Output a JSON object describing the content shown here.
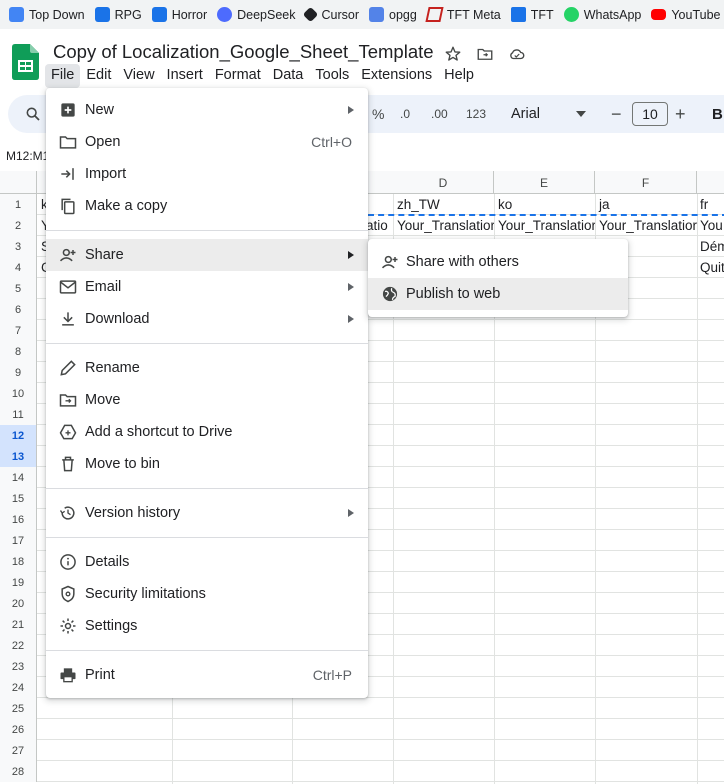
{
  "bookmarks": [
    {
      "label": "Top Down",
      "color": "#4285f4"
    },
    {
      "label": "RPG",
      "color": "#1a73e8"
    },
    {
      "label": "Horror",
      "color": "#1a73e8"
    },
    {
      "label": "DeepSeek",
      "color": "#4d6bfe"
    },
    {
      "label": "Cursor",
      "color": "#202124"
    },
    {
      "label": "opgg",
      "color": "#5383e8"
    },
    {
      "label": "TFT Meta",
      "color": "#c5221f"
    },
    {
      "label": "TFT",
      "color": "#1a73e8"
    },
    {
      "label": "WhatsApp",
      "color": "#25d366"
    },
    {
      "label": "YouTube",
      "color": "#ff0000"
    }
  ],
  "doc": {
    "title": "Copy of Localization_Google_Sheet_Template"
  },
  "menubar": [
    "File",
    "Edit",
    "View",
    "Insert",
    "Format",
    "Data",
    "Tools",
    "Extensions",
    "Help"
  ],
  "toolbar": {
    "percent": "%",
    "decimal_dec": ".0",
    "decimal_inc": ".00",
    "number_format": "123",
    "font": "Arial",
    "font_size": "10",
    "minus": "−",
    "plus": "+",
    "bold": "B"
  },
  "namebox": "M12:M1",
  "columns": [
    "D",
    "E",
    "F"
  ],
  "rows": [
    "1",
    "2",
    "3",
    "4",
    "5",
    "6",
    "7",
    "8",
    "9",
    "10",
    "11",
    "12",
    "13",
    "14",
    "15",
    "16",
    "17",
    "18",
    "19",
    "20",
    "21",
    "22",
    "23",
    "24",
    "25",
    "26",
    "27",
    "28"
  ],
  "selected_rows": [
    "12",
    "13"
  ],
  "cells": {
    "r1": [
      "k",
      "zh_TW",
      "ko",
      "ja",
      "fr"
    ],
    "r2": [
      "Y",
      "atio",
      "Your_Translatior",
      "Your_Translatior",
      "Your_Translatior",
      "You"
    ],
    "r3": [
      "S",
      "Dém"
    ],
    "r4": [
      "C",
      "Quit"
    ]
  },
  "file_menu": {
    "items": [
      {
        "label": "New",
        "icon": "new-sheet-icon",
        "submenu": true
      },
      {
        "label": "Open",
        "icon": "folder-open-icon",
        "shortcut": "Ctrl+O"
      },
      {
        "label": "Import",
        "icon": "import-icon"
      },
      {
        "label": "Make a copy",
        "icon": "copy-icon"
      },
      {
        "label": "Share",
        "icon": "person-add-icon",
        "submenu": true
      },
      {
        "label": "Email",
        "icon": "email-icon",
        "submenu": true
      },
      {
        "label": "Download",
        "icon": "download-icon",
        "submenu": true
      },
      {
        "label": "Rename",
        "icon": "pencil-icon"
      },
      {
        "label": "Move",
        "icon": "move-folder-icon"
      },
      {
        "label": "Add a shortcut to Drive",
        "icon": "drive-shortcut-icon"
      },
      {
        "label": "Move to bin",
        "icon": "trash-icon"
      },
      {
        "label": "Version history",
        "icon": "history-icon",
        "submenu": true
      },
      {
        "label": "Details",
        "icon": "info-icon"
      },
      {
        "label": "Security limitations",
        "icon": "security-icon"
      },
      {
        "label": "Settings",
        "icon": "gear-icon"
      },
      {
        "label": "Print",
        "icon": "printer-icon",
        "shortcut": "Ctrl+P"
      }
    ]
  },
  "share_submenu": {
    "items": [
      {
        "label": "Share with others",
        "icon": "person-add-icon"
      },
      {
        "label": "Publish to web",
        "icon": "globe-icon"
      }
    ]
  }
}
